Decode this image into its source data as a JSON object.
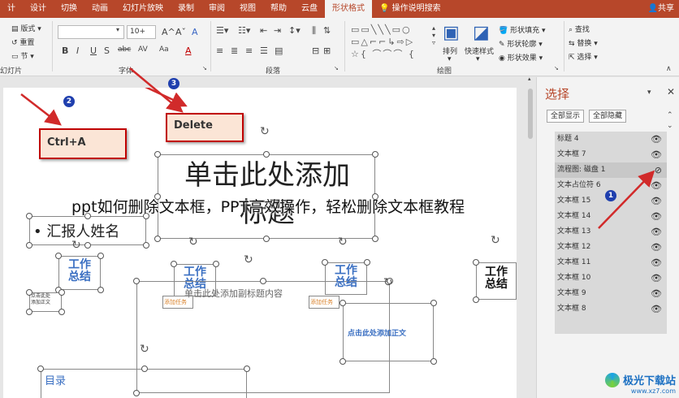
{
  "tabs": [
    "计",
    "设计",
    "切换",
    "动画",
    "幻灯片放映",
    "录制",
    "审阅",
    "视图",
    "帮助",
    "云盘",
    "形状格式",
    "操作说明搜索"
  ],
  "active_tab": "形状格式",
  "share": "共享",
  "ribbon": {
    "slides_group": {
      "layout": "版式",
      "reset": "重置",
      "section": "节",
      "label": "幻灯片"
    },
    "font_group": {
      "font_size": "10+",
      "label": "字体",
      "bold": "B",
      "italic": "I",
      "underline": "U",
      "strike": "S",
      "shadow": "abc",
      "grow": "A^",
      "shrink": "Aˇ",
      "clear": "A",
      "fontcolor": "A",
      "highlight": "AV",
      "case": "Aa"
    },
    "paragraph_group": {
      "label": "段落"
    },
    "drawing_group": {
      "label": "绘图",
      "arrange": "排列",
      "quick_styles": "快速样式",
      "fill": "形状填充",
      "outline": "形状轮廓",
      "effect": "形状效果"
    },
    "edit_group": {
      "find": "查找",
      "replace": "替换",
      "select": "选择"
    }
  },
  "slide": {
    "title_placeholder": "单击此处添加标题",
    "subtitle_placeholder": "单击此处添加副标题内容",
    "bullet_text": "• 汇报人姓名",
    "toc_text": "目录",
    "badge_text": "工作\n总结",
    "small_text_1": "点击此处\n添加正文",
    "small_text_2": "添加任务",
    "small_text_3": "点击此处添加正文"
  },
  "callouts": {
    "ctrl_a": "Ctrl+A",
    "delete": "Delete"
  },
  "step_numbers": [
    "1",
    "2",
    "3"
  ],
  "selection_pane": {
    "title": "选择",
    "show_all": "全部显示",
    "hide_all": "全部隐藏",
    "items": [
      "标题 4",
      "文本框 7",
      "流程图: 磁盘 1",
      "文本占位符 6",
      "文本框 15",
      "文本框 14",
      "文本框 13",
      "文本框 12",
      "文本框 11",
      "文本框 10",
      "文本框 9",
      "文本框 8"
    ]
  },
  "watermark": "ppt如何删除文本框，PPT高效操作，轻松删除文本框教程",
  "logo": {
    "name": "极光下载站",
    "url": "www.xz7.com"
  },
  "colors": {
    "accent": "#b7472a",
    "callout_border": "#c00000",
    "arrow": "#d12a2a",
    "number_badge": "#1f3fae"
  }
}
